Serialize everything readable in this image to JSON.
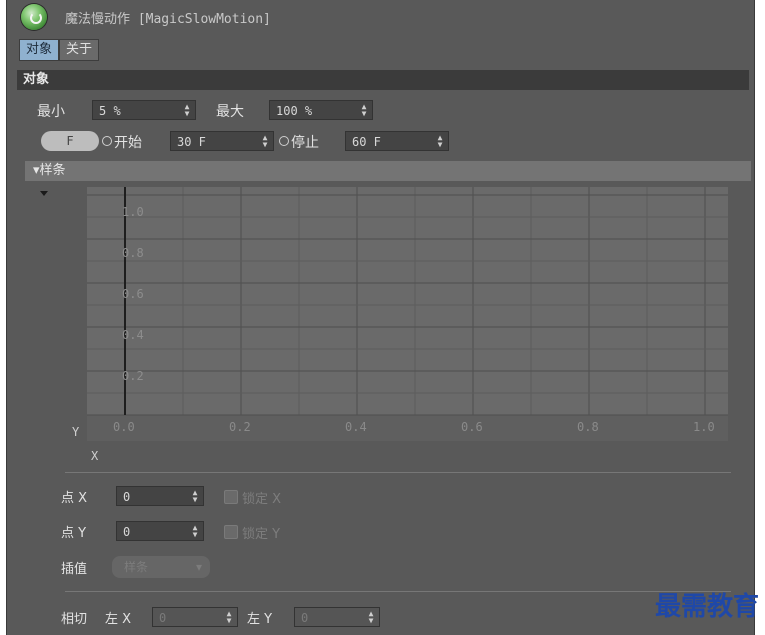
{
  "window": {
    "title": "魔法慢动作 [MagicSlowMotion]"
  },
  "tabs": [
    "对象",
    "关于"
  ],
  "object_section": {
    "header": "对象",
    "min_label": "最小",
    "min_value": "5 %",
    "max_label": "最大",
    "max_value": "100 %",
    "f_button": "F",
    "start_label": "开始",
    "start_value": "30 F",
    "stop_label": "停止",
    "stop_value": "60 F"
  },
  "spline": {
    "header": "▾样条",
    "y_ticks": [
      "1.0",
      "0.8",
      "0.6",
      "0.4",
      "0.2"
    ],
    "x_ticks": [
      "0.0",
      "0.2",
      "0.4",
      "0.6",
      "0.8",
      "1.0"
    ],
    "y_axis_label": "Y",
    "x_axis_label": "X",
    "point_x_label": "点 X",
    "point_x_value": "0",
    "lock_x_label": "锁定 X",
    "point_y_label": "点 Y",
    "point_y_value": "0",
    "lock_y_label": "锁定 Y",
    "interp_label": "插值",
    "interp_value": "样条",
    "tangent_label": "相切",
    "left_x_label": "左 X",
    "left_x_value": "0",
    "left_y_label": "左 Y",
    "left_y_value": "0"
  },
  "watermark": "最需教育",
  "colors": {
    "panel": "#595959",
    "active_tab": "#8fb1cf",
    "watermark": "#1f48a8"
  }
}
